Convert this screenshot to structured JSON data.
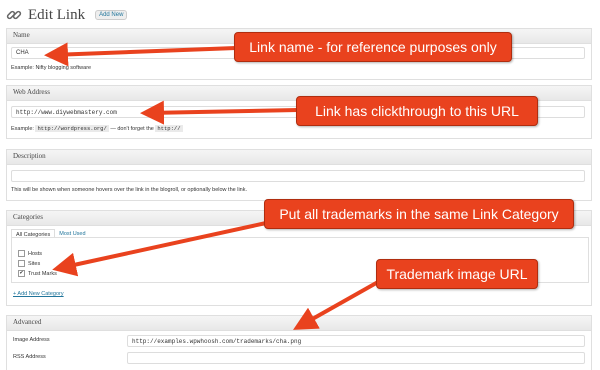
{
  "header": {
    "title": "Edit Link",
    "add_new_label": "Add New"
  },
  "name_section": {
    "heading": "Name",
    "value": "CHA",
    "help": "Example: Nifty blogging software"
  },
  "web_address_section": {
    "heading": "Web Address",
    "value": "http://www.diywebmastery.com",
    "help_prefix": "Example:",
    "help_code1": "http://wordpress.org/",
    "help_mid": "— don't forget the",
    "help_code2": "http://"
  },
  "description_section": {
    "heading": "Description",
    "value": "",
    "help": "This will be shown when someone hovers over the link in the blogroll, or optionally below the link."
  },
  "categories_section": {
    "heading": "Categories",
    "tabs": [
      "All Categories",
      "Most Used"
    ],
    "items": [
      {
        "label": "Hosts",
        "checked": false
      },
      {
        "label": "Sites",
        "checked": false
      },
      {
        "label": "Trust Marks",
        "checked": true
      }
    ],
    "add_new_label": "+ Add New Category"
  },
  "advanced_section": {
    "heading": "Advanced",
    "image_address_label": "Image Address",
    "image_address_value": "http://examples.wpwhoosh.com/trademarks/cha.png",
    "rss_address_label": "RSS Address",
    "rss_address_value": ""
  },
  "callouts": {
    "name": "Link name - for reference purposes only",
    "web_address": "Link has clickthrough to this URL",
    "categories": "Put all trademarks in the same Link Category",
    "image": "Trademark image URL"
  },
  "colors": {
    "callout": "#e9421e",
    "link": "#21759b"
  },
  "icons": {
    "title_icon": "chain-link-icon"
  }
}
